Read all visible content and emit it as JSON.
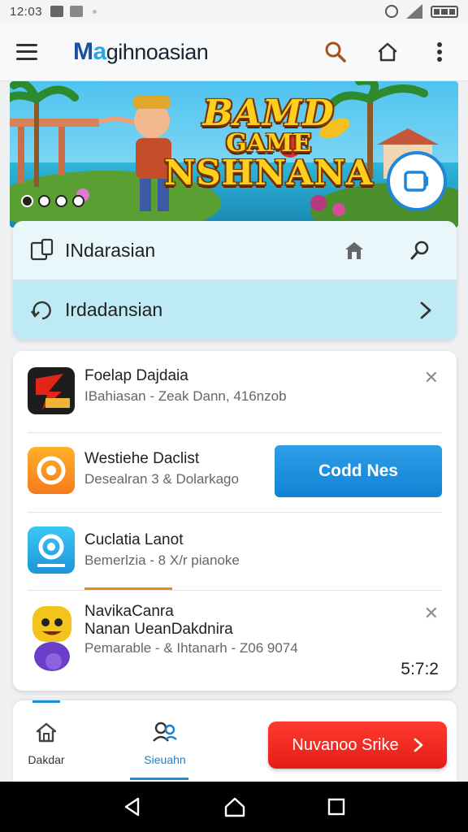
{
  "status_bar": {
    "time": "12:03"
  },
  "app_bar": {
    "brand_m": "M",
    "brand_a": "a",
    "brand_rest": "gihnoasian"
  },
  "banner": {
    "line1": "BAMD",
    "line2": "GAME",
    "line3": "NSHNANA"
  },
  "nav_card": {
    "row1_label": "INdarasian",
    "row2_label": "Irdadansian"
  },
  "list": {
    "items": [
      {
        "title": "Foelap Dajdaia",
        "subtitle": "IBahiasan - Zeak Dann, 416nzob",
        "badge": ""
      },
      {
        "title": "Westiehe Daclist",
        "subtitle": "Desealran 3 & Dolarkago"
      },
      {
        "title": "Cuclatia Lanot",
        "subtitle": "Bemerlzia - 8 X/r pianoke"
      },
      {
        "title": "NavikaCanra",
        "title2": "Nanan UeanDakdnira",
        "subtitle": "Pemarable - & Ihtanarh - Z06 9074"
      }
    ],
    "cta_blue": "Codd Nes",
    "score": "5:7:2"
  },
  "bottom_nav": {
    "home_label": "Dakdar",
    "search_label": "Sieuahn",
    "cta_red": "Nuvanoo Srike"
  },
  "colors": {
    "accent": "#1a8ed8",
    "red_cta": "#e41d18",
    "brand_dark": "#1b4fa0"
  }
}
